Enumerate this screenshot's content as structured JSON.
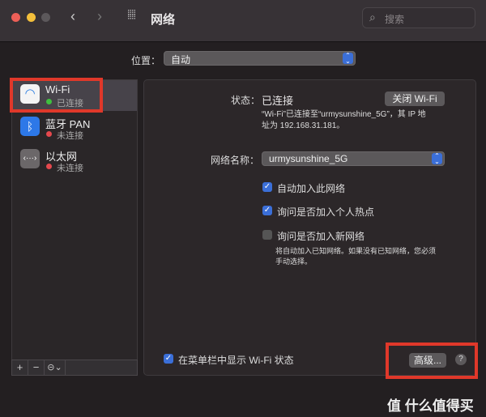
{
  "window": {
    "title": "网络",
    "search_placeholder": "搜索"
  },
  "location": {
    "label": "位置：",
    "value": "自动"
  },
  "sidebar": {
    "items": [
      {
        "name": "Wi-Fi",
        "status": "已连接",
        "status_color": "#3fbf3f"
      },
      {
        "name": "蓝牙 PAN",
        "status": "未连接",
        "status_color": "#e5484d"
      },
      {
        "name": "以太网",
        "status": "未连接",
        "status_color": "#e5484d"
      }
    ],
    "add": "+",
    "remove": "−",
    "actions": "⊝⌄"
  },
  "detail": {
    "status_label": "状态：",
    "status_value": "已连接",
    "turn_off_button": "关闭 Wi-Fi",
    "status_desc_1": "“Wi-Fi”已连接至“urmysunshine_5G”，其 IP 地",
    "status_desc_2": "址为 192.168.31.181。",
    "network_name_label": "网络名称：",
    "network_name_value": "urmysunshine_5G",
    "checkboxes": [
      {
        "label": "自动加入此网络",
        "checked": true
      },
      {
        "label": "询问是否加入个人热点",
        "checked": true
      },
      {
        "label": "询问是否加入新网络",
        "checked": false
      }
    ],
    "hint_1": "将自动加入已知网络。如果没有已知网络，您必须",
    "hint_2": "手动选择。",
    "show_in_menubar": "在菜单栏中显示 Wi-Fi 状态",
    "advanced_button": "高级...",
    "help": "?"
  },
  "watermark": "值 什么值得买"
}
